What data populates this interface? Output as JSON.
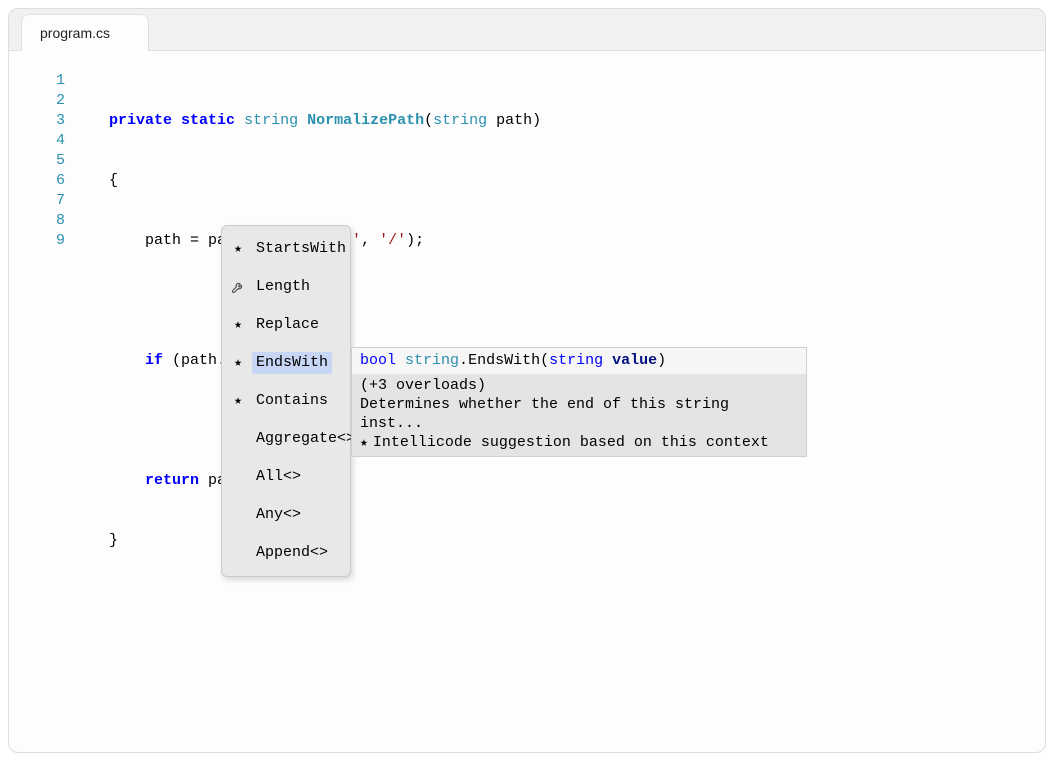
{
  "tab": {
    "label": "program.cs"
  },
  "gutter": {
    "lines": [
      "1",
      "2",
      "3",
      "4",
      "5",
      "6",
      "7",
      "8",
      "9"
    ]
  },
  "code": {
    "l1": {
      "kw1": "private",
      "kw2": "static",
      "type1": "string",
      "mname": "NormalizePath",
      "open": "(",
      "ptype": "string",
      "pname": " path)",
      "close": ""
    },
    "l2": "{",
    "l3": {
      "pre": "    path = path.Replace(",
      "s1": "'\\\\'",
      "comma": ", ",
      "s2": "'/'",
      "post": ");"
    },
    "l4": "",
    "l5": {
      "pre": "    ",
      "kw": "if",
      "post": " (path.)"
    },
    "l6": "",
    "l7": {
      "pre": "    ",
      "kw": "return",
      "post": " pa"
    },
    "l8": "}",
    "l9": ""
  },
  "intellisense": {
    "items": [
      {
        "icon": "star",
        "label": "StartsWith"
      },
      {
        "icon": "wrench",
        "label": "Length"
      },
      {
        "icon": "star",
        "label": "Replace"
      },
      {
        "icon": "star",
        "label": "EndsWith",
        "selected": true
      },
      {
        "icon": "star",
        "label": "Contains"
      },
      {
        "icon": "",
        "label": "Aggregate<>"
      },
      {
        "icon": "",
        "label": "All<>"
      },
      {
        "icon": "",
        "label": "Any<>"
      },
      {
        "icon": "",
        "label": "Append<>"
      }
    ]
  },
  "tooltip": {
    "sig": {
      "ret": "bool",
      "owner": "string",
      "dot": ".",
      "method": "EndsWith(",
      "ptype": "string",
      "pname": "value",
      "close": ")"
    },
    "overloads": "(+3 overloads)",
    "desc": "Determines whether the end of this string inst...",
    "hint": "Intellicode suggestion based on this context"
  }
}
